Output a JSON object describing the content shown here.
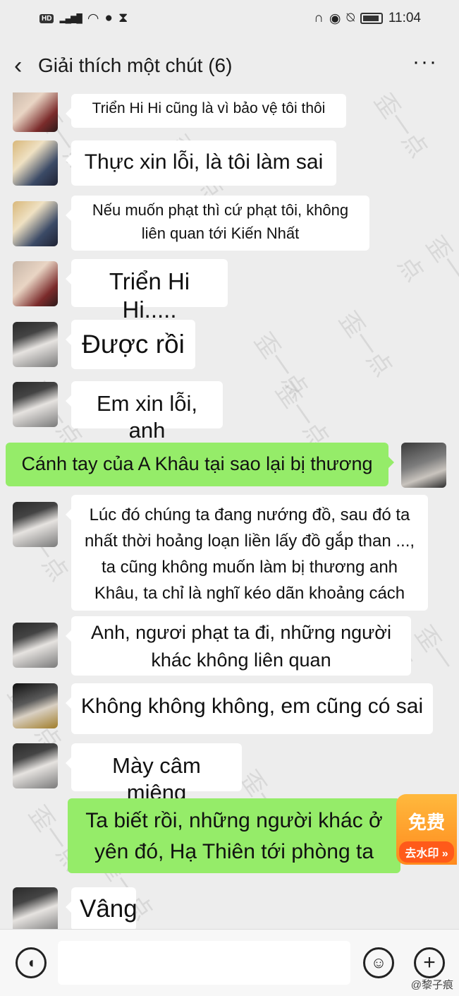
{
  "status_bar": {
    "hd": "HD",
    "network": "4G",
    "time": "11:04"
  },
  "header": {
    "title": "Giải thích một chút (6)",
    "back_icon": "chevron-left-icon",
    "more_icon": "more-icon"
  },
  "messages": [
    {
      "side": "left",
      "avatar": "av-a",
      "text": "Triển Hi Hi cũng là vì bảo vệ tôi thôi"
    },
    {
      "side": "left",
      "avatar": "av-b",
      "text": "Thực xin lỗi, là tôi làm sai"
    },
    {
      "side": "left",
      "avatar": "av-b",
      "text_line1": "Nếu muốn phạt thì cứ phạt tôi, không",
      "text_line2": "liên quan tới Kiến Nhất"
    },
    {
      "side": "left",
      "avatar": "av-a",
      "text": "Triển Hi Hi....."
    },
    {
      "side": "left",
      "avatar": "av-c",
      "text": "Được rồi"
    },
    {
      "side": "left",
      "avatar": "av-c",
      "text": "Em xin lỗi, anh"
    },
    {
      "side": "right",
      "avatar": "av-e",
      "text": "Cánh tay của A Khâu tại sao lại bị thương"
    },
    {
      "side": "left",
      "avatar": "av-c",
      "lines": [
        "Lúc đó chúng ta đang nướng đồ, sau đó ta",
        "nhất thời hoảng loạn liền lấy đồ gắp than ...,",
        "ta cũng không muốn làm bị thương anh",
        "Khâu, ta chỉ là nghĩ kéo dãn khoảng cách"
      ]
    },
    {
      "side": "left",
      "avatar": "av-c",
      "lines": [
        "Anh, ngươi phạt ta đi, những người",
        "khác không liên quan"
      ]
    },
    {
      "side": "left",
      "avatar": "av-d",
      "text": "Không không không, em cũng có sai"
    },
    {
      "side": "left",
      "avatar": "av-c",
      "text": "Mày câm miệng"
    },
    {
      "side": "right",
      "lines": [
        "Ta biết rồi, những người khác ở",
        "yên đó, Hạ Thiên tới phòng ta"
      ]
    },
    {
      "side": "left",
      "avatar": "av-c",
      "text": "Vâng"
    }
  ],
  "promo": {
    "line1": "免费",
    "line2": "去水印 »"
  },
  "input_bar": {
    "voice_icon": "voice-icon",
    "emoji_icon": "emoji-icon",
    "plus_icon": "plus-icon"
  },
  "watermark": {
    "weibo": "@黎子痕",
    "mark": "歪一点"
  }
}
